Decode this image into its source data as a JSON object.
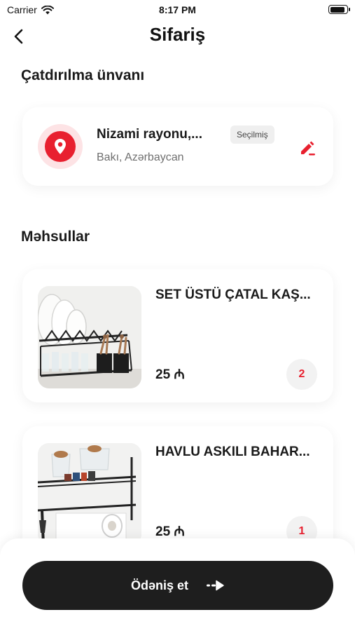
{
  "status_bar": {
    "carrier": "Carrier",
    "time": "8:17 PM",
    "battery_level": 0.9
  },
  "header": {
    "title": "Sifariş",
    "back_icon": "chevron-left-icon"
  },
  "delivery": {
    "section_title": "Çatdırılma ünvanı",
    "address_name": "Nizami rayonu,...",
    "address_sub": "Bakı, Azərbaycan",
    "badge": "Seçilmiş",
    "pin_icon": "location-pin-icon",
    "edit_icon": "edit-pencil-icon",
    "accent_color": "#e8202f"
  },
  "products": {
    "section_title": "Məhsullar",
    "items": [
      {
        "name": "SET ÜSTÜ ÇATAL KAŞ...",
        "price": "25 ₼",
        "quantity": "2"
      },
      {
        "name": "HAVLU ASKILI BAHAR...",
        "price": "25 ₼",
        "quantity": "1"
      }
    ]
  },
  "checkout": {
    "button_label": "Ödəniş et",
    "button_icon": "arrow-right-icon"
  }
}
